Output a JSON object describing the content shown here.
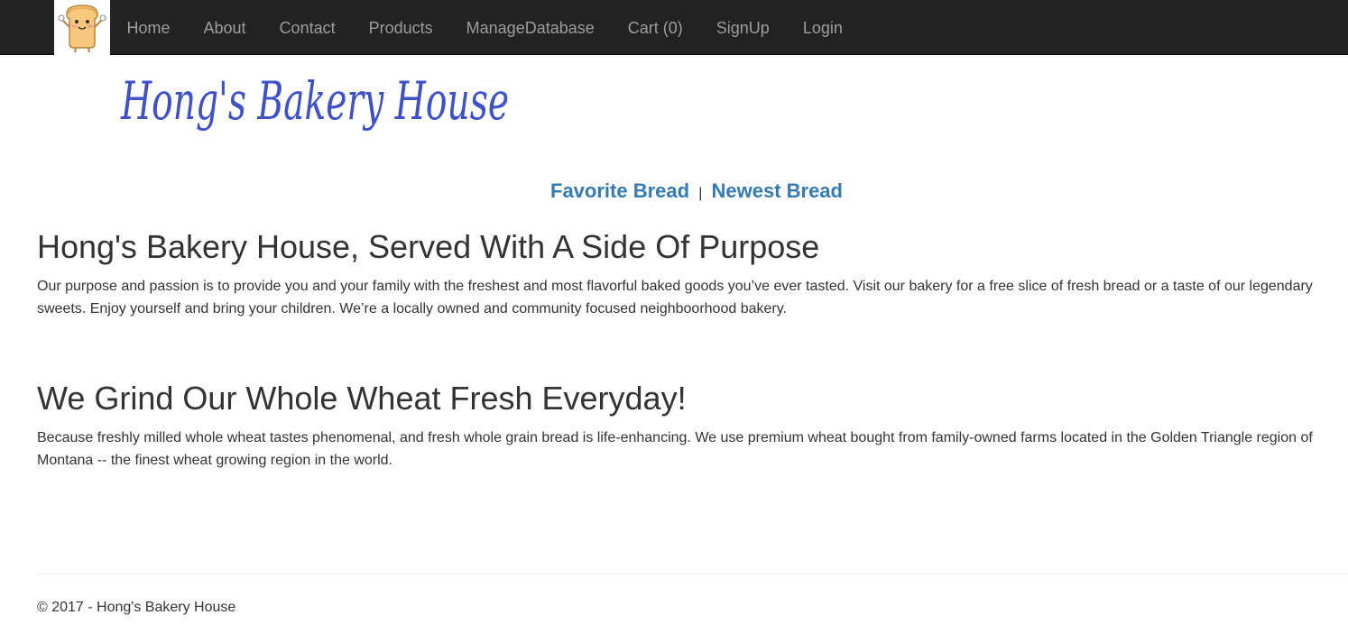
{
  "nav": {
    "logo_icon": "bread-mascot-icon",
    "items": [
      {
        "label": "Home"
      },
      {
        "label": "About"
      },
      {
        "label": "Contact"
      },
      {
        "label": "Products"
      },
      {
        "label": "ManageDatabase"
      },
      {
        "label": "Cart (0)"
      },
      {
        "label": "SignUp"
      },
      {
        "label": "Login"
      }
    ]
  },
  "banner": {
    "title": "Hong's Bakery House",
    "color": "#3f51c8"
  },
  "bread_links": {
    "favorite": "Favorite Bread",
    "separator": "|",
    "newest": "Newest Bread",
    "color": "#337ab7"
  },
  "sections": [
    {
      "heading": "Hong's Bakery House, Served With A Side Of Purpose",
      "body": "Our purpose and passion is to provide you and your family with the freshest and most flavorful baked goods you’ve ever tasted. Visit our bakery for a free slice of fresh bread or a taste of our legendary sweets. Enjoy yourself and bring your children. We’re a locally owned and community focused neighboorhood bakery."
    },
    {
      "heading": "We Grind Our Whole Wheat Fresh Everyday!",
      "body": "Because freshly milled whole wheat tastes phenomenal, and fresh whole grain bread is life-enhancing. We use premium wheat bought from family-owned farms located in the Golden Triangle region of Montana -- the finest wheat growing region in the world."
    }
  ],
  "footer": {
    "copyright": "© 2017 - Hong's Bakery House"
  }
}
